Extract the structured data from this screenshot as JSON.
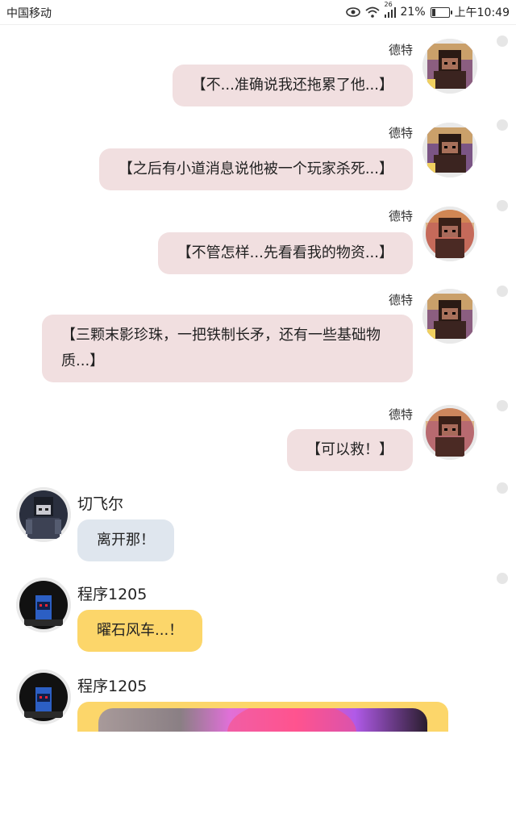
{
  "status_bar": {
    "carrier": "中国移动",
    "signal_label": "26",
    "battery_percent": "21%",
    "time": "上午10:49",
    "battery_level": 0.21
  },
  "messages": [
    {
      "sender": "德特",
      "text": "【不...准确说我还拖累了他...】"
    },
    {
      "sender": "德特",
      "text": "【之后有小道消息说他被一个玩家杀死...】"
    },
    {
      "sender": "德特",
      "text": "【不管怎样...先看看我的物资...】"
    },
    {
      "sender": "德特",
      "text": "【三颗末影珍珠，一把铁制长矛，还有一些基础物质...】"
    },
    {
      "sender": "德特",
      "text": "【可以救！】"
    },
    {
      "sender": "切飞尔",
      "text": "离开那！"
    },
    {
      "sender": "程序1205",
      "text": "曜石风车...！"
    },
    {
      "sender": "程序1205",
      "text": ""
    }
  ],
  "icons": {
    "eye": "eye-icon",
    "wifi": "wifi-icon",
    "signal": "signal-icon",
    "battery": "battery-icon"
  },
  "colors": {
    "pink_bubble": "#f1dfe0",
    "blue_bubble": "#dfe6ee",
    "yellow_bubble": "#fcd66a"
  }
}
